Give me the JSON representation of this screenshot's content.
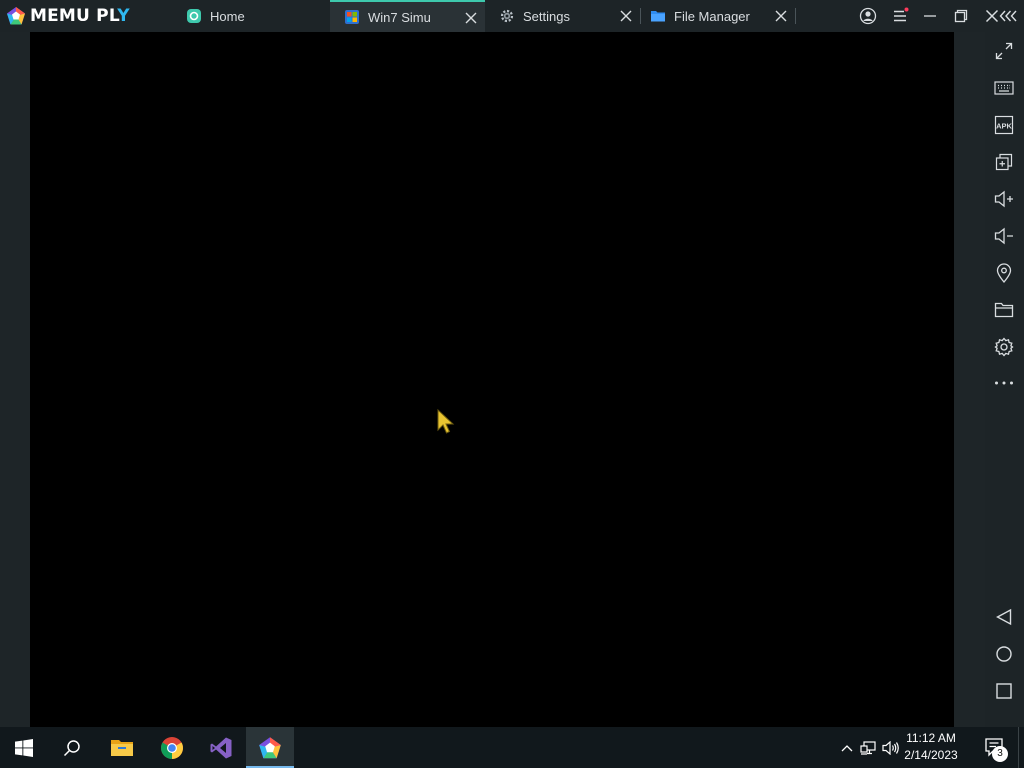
{
  "app": {
    "logo_text_main": "MEMU PL",
    "logo_text_accent": "Y",
    "logo_icon": "memu-pentagon-logo"
  },
  "tabs": [
    {
      "label": "Home",
      "icon": "memu-home-icon",
      "active": false,
      "closable": false
    },
    {
      "label": "Win7 Simu",
      "icon": "win7-simu-icon",
      "active": true,
      "closable": true
    },
    {
      "label": "Settings",
      "icon": "gear-icon",
      "active": false,
      "closable": true
    },
    {
      "label": "File Manager",
      "icon": "folder-icon",
      "active": false,
      "closable": true
    }
  ],
  "window_controls": [
    "account-icon",
    "menu-icon",
    "minimize-icon",
    "restore-icon",
    "close-icon",
    "collapse-sidebar-icon"
  ],
  "toolbar": {
    "top": [
      "fullscreen",
      "keyboard-mapping",
      "install-apk",
      "multi-instance",
      "volume-up",
      "volume-down",
      "location",
      "shared-folder",
      "settings",
      "more"
    ],
    "bottom": [
      "android-back",
      "android-home",
      "android-recent"
    ],
    "apk_label": "APK"
  },
  "taskbar": {
    "items": [
      "windows-start",
      "search",
      "file-explorer",
      "chrome",
      "visual-studio",
      "memu-play"
    ],
    "active_item": "memu-play",
    "clock_time": "11:12 AM",
    "clock_date": "2/14/2023",
    "notification_count": "3"
  },
  "colors": {
    "accent_teal": "#3ec9ad",
    "brand_blue": "#2fb8f0",
    "taskbar_active_line": "#76b9ed",
    "cursor_yellow": "#e8c431"
  }
}
